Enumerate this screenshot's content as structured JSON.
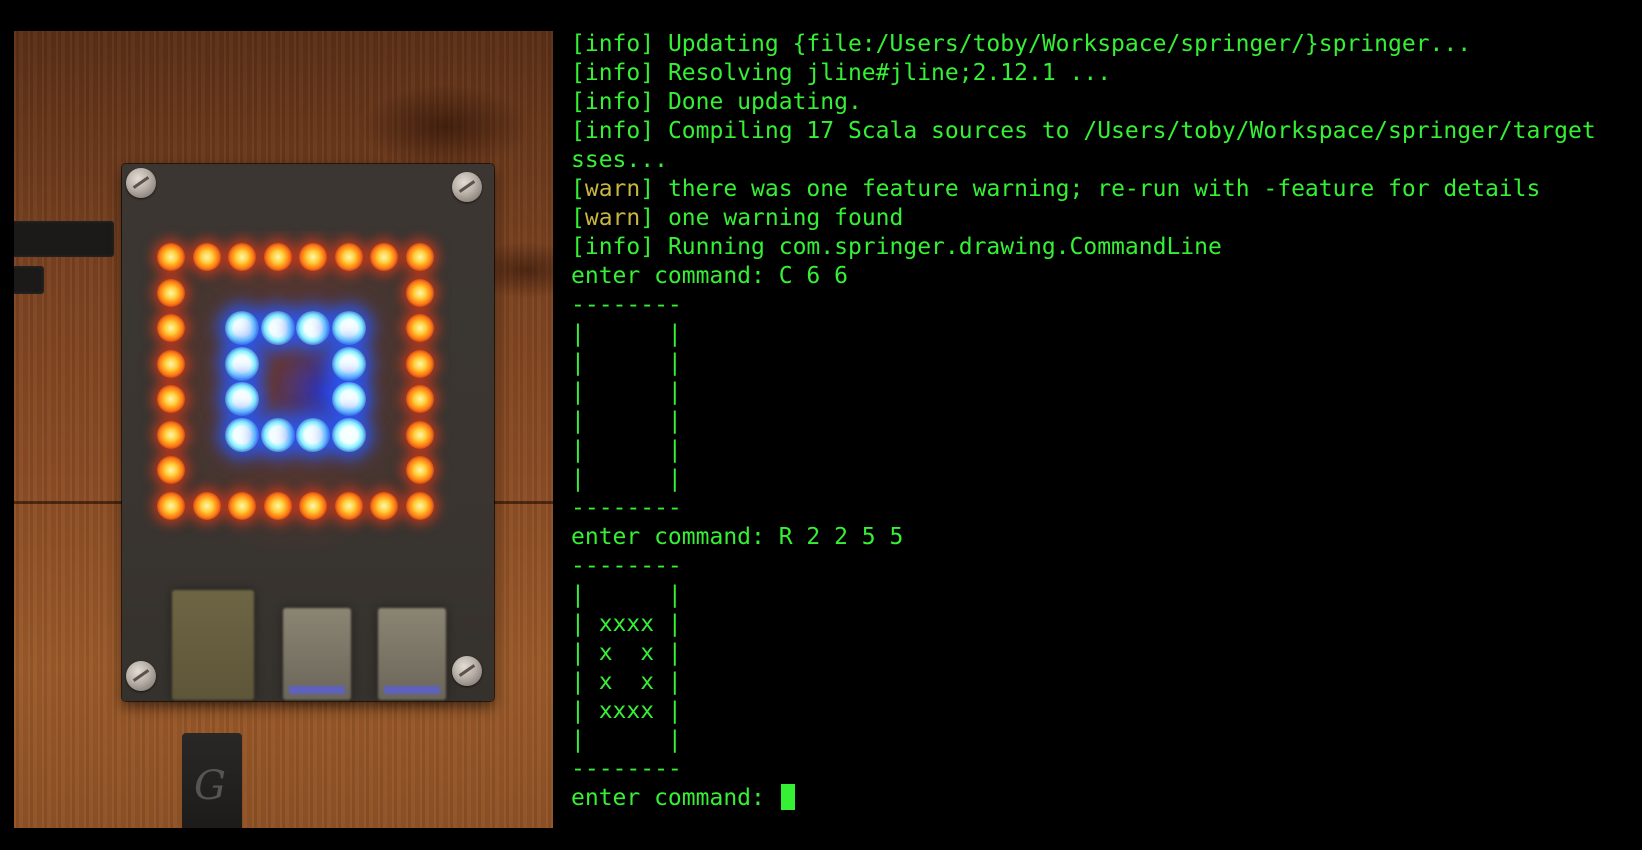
{
  "photo": {
    "alt": "LED matrix device on wooden table",
    "led_matrix": {
      "size": 8,
      "outer_color": "#ff8a1a",
      "inner_color": "#40c8ff"
    }
  },
  "terminal": {
    "lines": [
      {
        "tag": "[info]",
        "text": " Updating {file:/Users/toby/Workspace/springer/}springer..."
      },
      {
        "tag": "[info]",
        "text": " Resolving jline#jline;2.12.1 ..."
      },
      {
        "tag": "[info]",
        "text": " Done updating."
      },
      {
        "tag": "[info]",
        "text": " Compiling 17 Scala sources to /Users/toby/Workspace/springer/target"
      },
      {
        "tag": "",
        "text": "sses..."
      },
      {
        "tag": "[warn]",
        "text": " there was one feature warning; re-run with -feature for details"
      },
      {
        "tag": "[warn]",
        "text": " one warning found"
      },
      {
        "tag": "[info]",
        "text": " Running com.springer.drawing.CommandLine"
      },
      {
        "tag": "",
        "text": "enter command: C 6 6"
      },
      {
        "tag": "",
        "text": "--------"
      },
      {
        "tag": "",
        "text": "|      |"
      },
      {
        "tag": "",
        "text": "|      |"
      },
      {
        "tag": "",
        "text": "|      |"
      },
      {
        "tag": "",
        "text": "|      |"
      },
      {
        "tag": "",
        "text": "|      |"
      },
      {
        "tag": "",
        "text": "|      |"
      },
      {
        "tag": "",
        "text": "--------"
      },
      {
        "tag": "",
        "text": "enter command: R 2 2 5 5"
      },
      {
        "tag": "",
        "text": "--------"
      },
      {
        "tag": "",
        "text": "|      |"
      },
      {
        "tag": "",
        "text": "| xxxx |"
      },
      {
        "tag": "",
        "text": "| x  x |"
      },
      {
        "tag": "",
        "text": "| x  x |"
      },
      {
        "tag": "",
        "text": "| xxxx |"
      },
      {
        "tag": "",
        "text": "|      |"
      },
      {
        "tag": "",
        "text": "--------"
      }
    ],
    "prompt": "enter command: ",
    "input_value": ""
  },
  "colors": {
    "text": "#35f035",
    "warn": "#c8b642",
    "background": "#000000"
  }
}
